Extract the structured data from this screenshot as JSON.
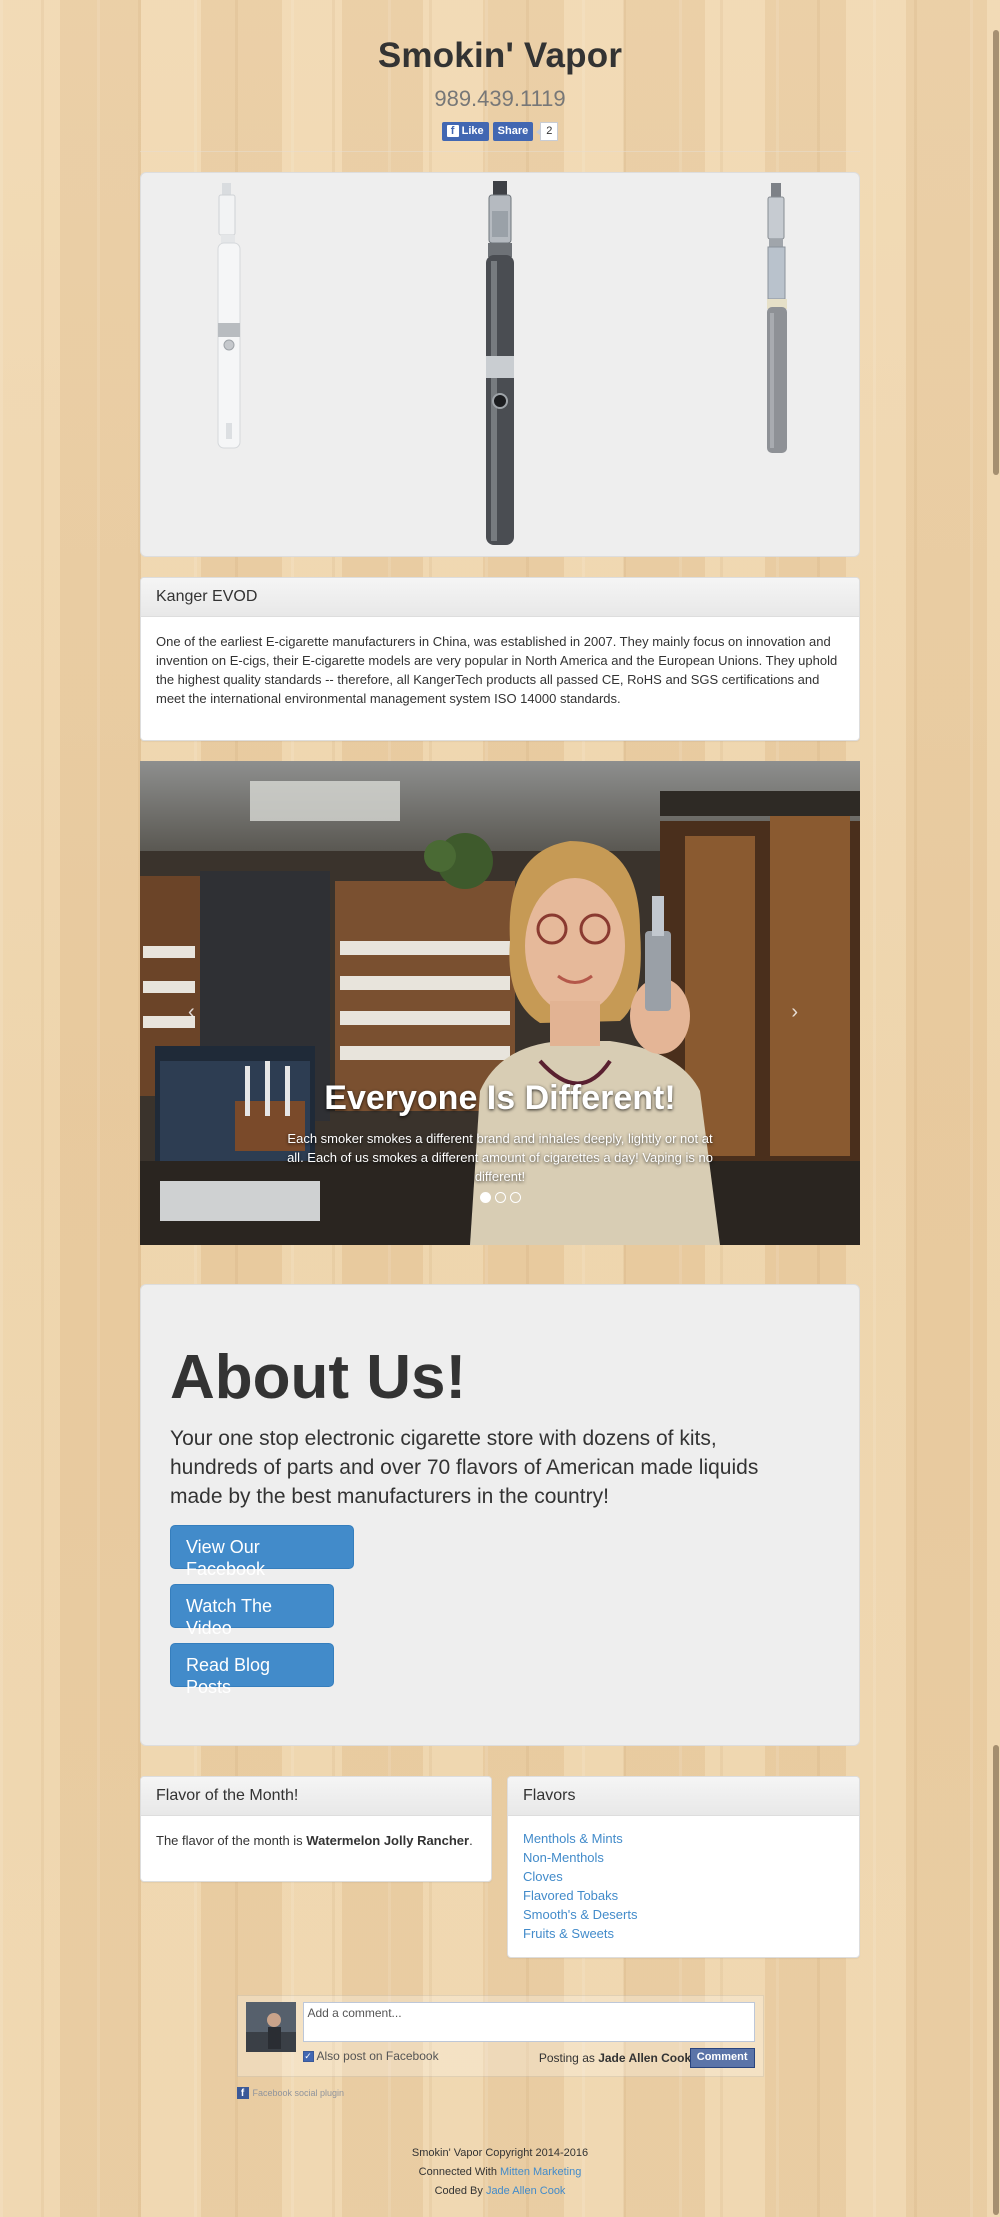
{
  "header": {
    "title": "Smokin' Vapor",
    "phone": "989.439.1119",
    "fb_like_label": "Like",
    "fb_share_label": "Share",
    "fb_count": "2"
  },
  "product_card": {
    "title": "Kanger EVOD",
    "body": "One of the earliest E-cigarette manufacturers in China, was established in 2007. They mainly focus on innovation and invention on E-cigs, their E-cigarette models are very popular in North America and the European Unions. They uphold the highest quality standards -- therefore, all KangerTech products all passed CE, RoHS and SGS certifications and meet the international environmental management system ISO 14000 standards."
  },
  "carousel": {
    "heading": "Everyone Is Different!",
    "text": "Each smoker smokes a different brand and inhales deeply, lightly or not at all. Each of us smokes a different amount of cigarettes a day! Vaping is no different!",
    "prev_icon": "chevron-left-icon",
    "next_icon": "chevron-right-icon",
    "slide_count": 3,
    "active_slide": 1
  },
  "about": {
    "heading": "About Us!",
    "text": "Your one stop electronic cigarette store with dozens of kits, hundreds of parts and over 70 flavors of American made liquids made by the best manufacturers in the country!",
    "buttons": [
      "View Our Facebook",
      "Watch The Video",
      "Read Blog Posts"
    ]
  },
  "flavor_month": {
    "title": "Flavor of the Month!",
    "text_prefix": "The flavor of the month is ",
    "flavor": "Watermelon Jolly Rancher",
    "text_suffix": "."
  },
  "flavors": {
    "title": "Flavors",
    "items": [
      "Menthols & Mints",
      "Non-Menthols",
      "Cloves",
      "Flavored Tobaks",
      "Smooth's & Deserts",
      "Fruits & Sweets"
    ]
  },
  "comments": {
    "placeholder": "Add a comment...",
    "also_post": "Also post on Facebook",
    "posting_as_prefix": "Posting as ",
    "user": "Jade Allen Cook",
    "comment_button": "Comment",
    "plugin_label": "Facebook social plugin"
  },
  "footer": {
    "copyright": "Smokin' Vapor Copyright 2014-2016",
    "connected_prefix": "Connected With ",
    "connected_link": "Mitten Marketing",
    "coded_prefix": "Coded By ",
    "coded_link": "Jade Allen Cook"
  },
  "colors": {
    "link": "#428bca",
    "button": "#428bca",
    "facebook": "#4267b2"
  }
}
